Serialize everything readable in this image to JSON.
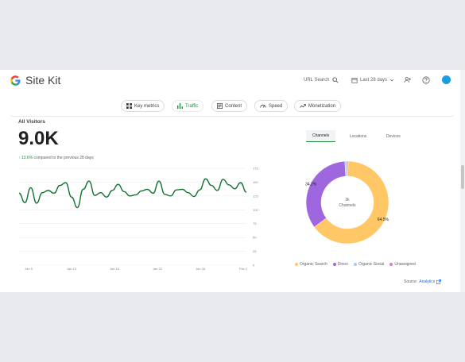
{
  "header": {
    "brand": "Site Kit",
    "url_search": "URL Search",
    "date_range": "Last 28 days"
  },
  "nav_tabs": [
    {
      "label": "Key metrics",
      "icon": "grid-icon",
      "active": false
    },
    {
      "label": "Traffic",
      "icon": "bar-chart-icon",
      "active": true
    },
    {
      "label": "Content",
      "icon": "document-icon",
      "active": false
    },
    {
      "label": "Speed",
      "icon": "speedometer-icon",
      "active": false
    },
    {
      "label": "Monetization",
      "icon": "trending-icon",
      "active": false
    }
  ],
  "traffic": {
    "title": "All Visitors",
    "value": "9.0K",
    "change_pct": "13.6%",
    "change_text": "compared to the previous 28 days"
  },
  "chart_data": {
    "type": "line",
    "x_tick_labels": [
      "Jan 9",
      "Jan 13",
      "Jan 16",
      "Jan 22",
      "Jan 26",
      "Feb 2"
    ],
    "y_tick_labels": [
      "175",
      "150",
      "125",
      "100",
      "75",
      "50",
      "25",
      "0"
    ],
    "ylim": [
      0,
      175
    ],
    "series": [
      {
        "values": [
          130,
          113,
          140,
          112,
          131,
          135,
          130,
          144,
          149,
          123,
          104,
          137,
          152,
          126,
          131,
          123,
          135,
          146,
          133,
          125,
          127,
          134,
          137,
          130,
          152,
          128,
          125,
          136,
          137,
          131,
          124,
          136,
          156,
          144,
          135,
          155,
          145,
          138,
          149,
          132
        ],
        "color": "#137333"
      }
    ],
    "grid": true
  },
  "channels": {
    "tabs": [
      "Channels",
      "Locations",
      "Devices"
    ],
    "active_tab": "Channels",
    "donut_center": [
      "3k",
      "Channels"
    ],
    "chart_data": {
      "type": "pie",
      "slices": [
        {
          "name": "Organic Search",
          "value": 64.5,
          "label": "64.5%",
          "color": "#ffc766"
        },
        {
          "name": "Direct",
          "value": 34.2,
          "label": "34.2%",
          "color": "#9e67e0"
        },
        {
          "name": "Organic Social",
          "value": 0.8,
          "label": "",
          "color": "#a8ccef"
        },
        {
          "name": "Unassigned",
          "value": 0.5,
          "label": "",
          "color": "#d87dd1"
        }
      ]
    },
    "legend": [
      "Organic Search",
      "Direct",
      "Organic Social",
      "Unassigned"
    ]
  },
  "source": {
    "label": "Source:",
    "link": "Analytics"
  }
}
